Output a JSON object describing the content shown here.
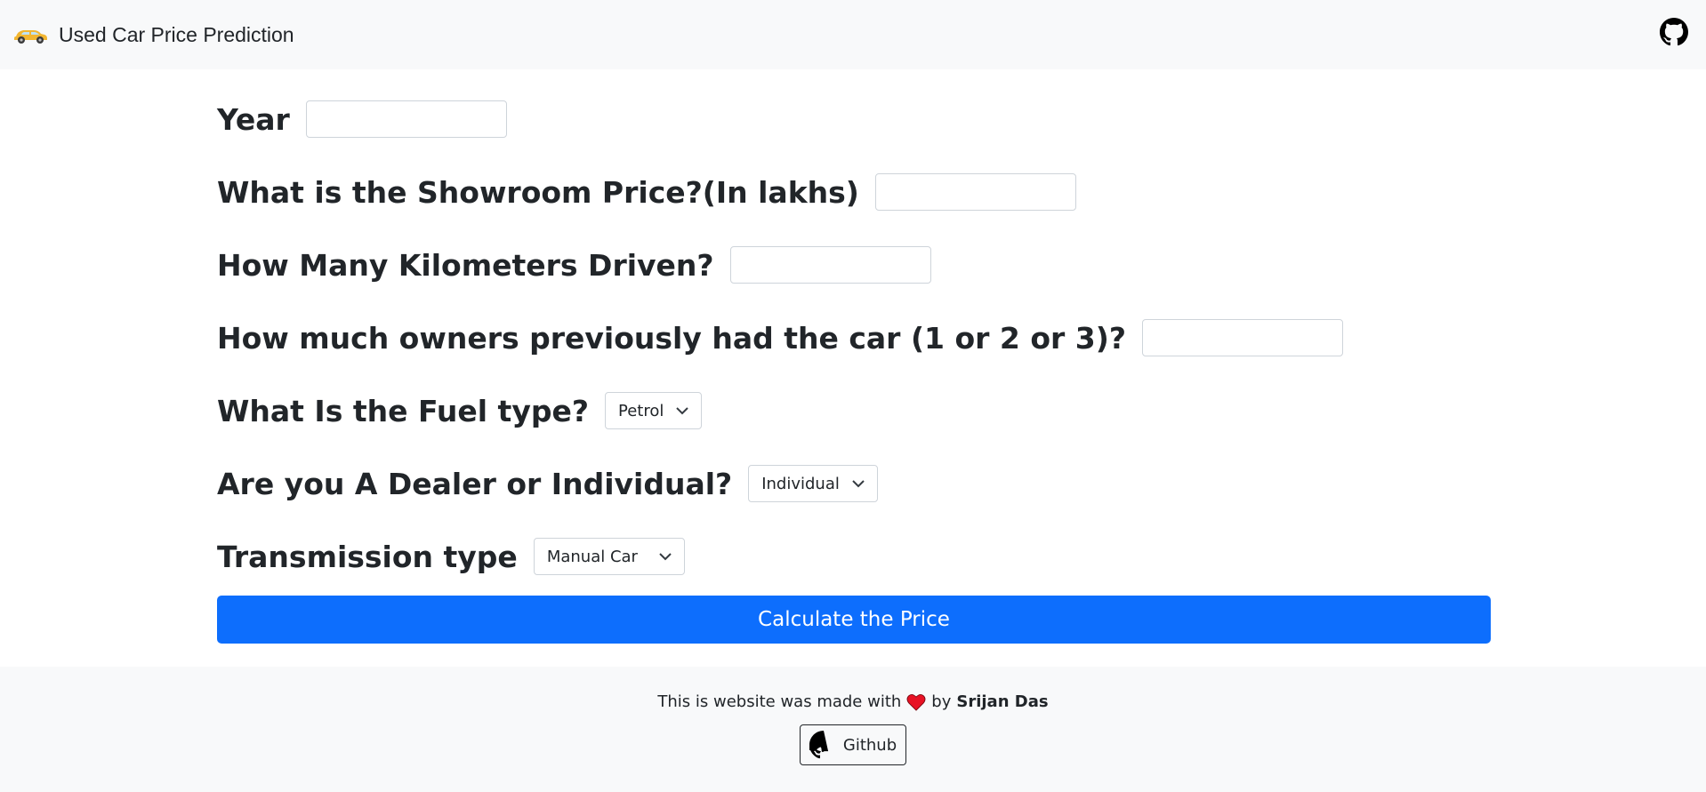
{
  "navbar": {
    "brand_icon": "car-icon",
    "brand_text": "Used Car Price Prediction",
    "github_icon": "github-icon"
  },
  "form": {
    "year_label": "Year",
    "year_value": "",
    "showroom_label": "What is the Showroom Price?(In lakhs)",
    "showroom_value": "",
    "kms_label": "How Many Kilometers Driven?",
    "kms_value": "",
    "owners_label": "How much owners previously had the car (1 or 2 or 3)?",
    "owners_value": "",
    "fuel_label": "What Is the Fuel type?",
    "fuel_selected": "Petrol",
    "seller_label": "Are you A Dealer or Individual?",
    "seller_selected": "Individual",
    "transmission_label": "Transmission type",
    "transmission_selected": "Manual Car",
    "submit_label": "Calculate the Price"
  },
  "footer": {
    "made_with": "This is website was made with",
    "heart_icon": "heart-icon",
    "by": "by",
    "author": "Srijan Das",
    "github_button": "Github"
  },
  "colors": {
    "primary": "#0d6efd",
    "navbar_bg": "#f8f9fa",
    "text": "#212529",
    "heart": "#e81224"
  }
}
